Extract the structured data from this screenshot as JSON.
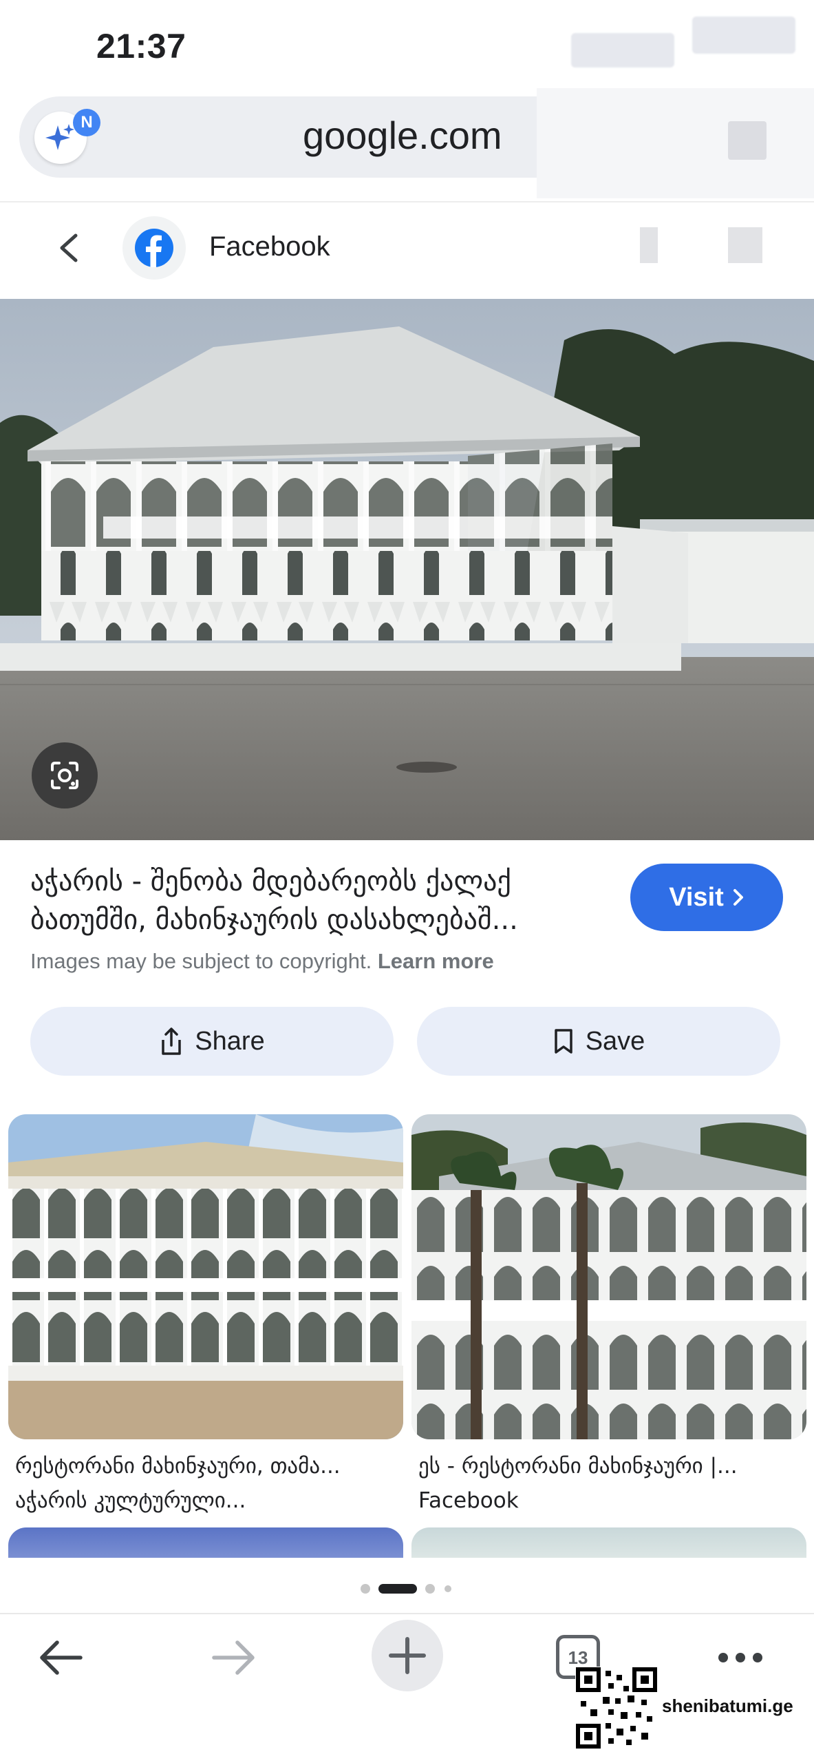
{
  "status_bar": {
    "time": "21:37"
  },
  "address_bar": {
    "url": "google.com",
    "badge_letter": "N"
  },
  "header": {
    "source_name": "Facebook"
  },
  "result": {
    "caption_line1": "აჭარის - შენობა მდებარეობს ქალაქ",
    "caption_line2": "ბათუმში, მახინჯაურის დასახლებაშ...",
    "visit_label": "Visit",
    "copyright_text": "Images may be subject to copyright.",
    "learn_more": "Learn more",
    "share_label": "Share",
    "save_label": "Save"
  },
  "related": [
    {
      "title": "რესტორანი მახინჯაური, თამა...",
      "source": "აჭარის კულტურული..."
    },
    {
      "title": "ეს - რესტორანი მახინჯაური |...",
      "source": "Facebook"
    }
  ],
  "toolbar": {
    "tab_count": "13"
  },
  "watermark": {
    "site": "shenibatumi.ge"
  },
  "colors": {
    "accent": "#2f6ee6",
    "pill_bg": "#e9eef9",
    "url_bar_bg": "#eceef2"
  }
}
